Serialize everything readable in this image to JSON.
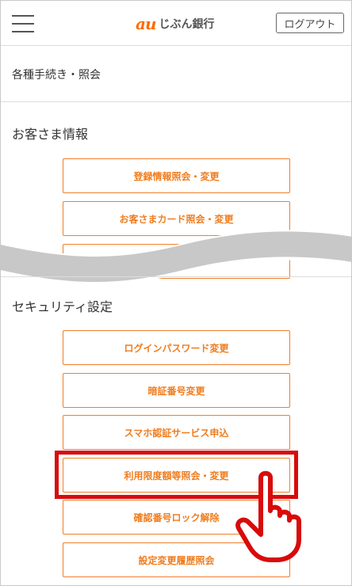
{
  "header": {
    "logo_mark": "au",
    "logo_text": "じぶん銀行",
    "logout_label": "ログアウト"
  },
  "breadcrumb": "各種手続き・照会",
  "customer_section": {
    "title": "お客さま情報",
    "buttons": [
      "登録情報照会・変更",
      "お客さまカード照会・変更"
    ]
  },
  "security_section": {
    "title": "セキュリティ設定",
    "buttons": [
      "ログインパスワード変更",
      "暗証番号変更",
      "スマホ認証サービス申込",
      "利用限度額等照会・変更",
      "確認番号ロック解除",
      "設定変更履歴照会"
    ]
  },
  "colors": {
    "accent": "#ef7d1f",
    "highlight": "#d80b0b",
    "wave": "#c8c8c8"
  },
  "icons": [
    "menu-icon",
    "logo",
    "pointing-hand-icon"
  ]
}
